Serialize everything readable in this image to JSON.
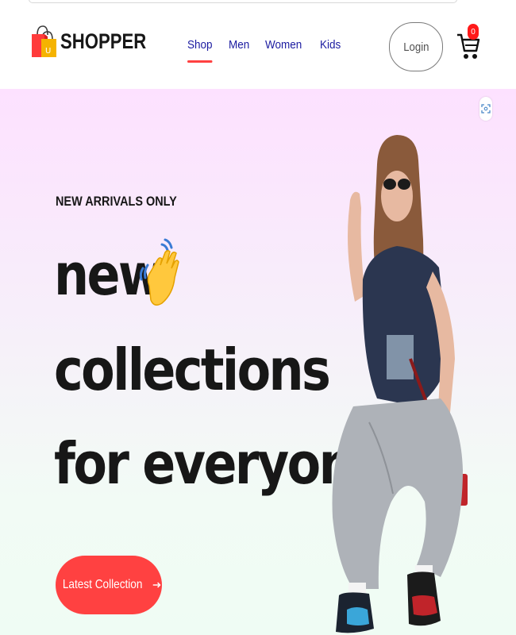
{
  "brand": {
    "name": "SHOPPER",
    "bag_letter": "U",
    "colors": {
      "bag_red": "#ff3b3b",
      "bag_yellow": "#f5b300",
      "text": "#171717"
    }
  },
  "nav": {
    "items": [
      {
        "label": "Shop",
        "active": true
      },
      {
        "label": "Men",
        "active": false
      },
      {
        "label": "Women",
        "active": false
      },
      {
        "label": "Kids",
        "active": false
      }
    ],
    "link_color": "#1a1aa0",
    "active_underline_color": "#ff4141"
  },
  "login": {
    "label": "Login"
  },
  "cart": {
    "icon": "cart-icon",
    "count": "0",
    "badge_color": "#ff1a1a"
  },
  "hero": {
    "eyebrow": "NEW ARRIVALS ONLY",
    "line1": "new",
    "line2": "collections",
    "line3": "for everyone",
    "hand_icon": "waving-hand-icon",
    "cta_label": "Latest Collection",
    "cta_icon": "arrow-right-icon",
    "cta_color": "#ff4141",
    "gradient_top": "#fde1ff",
    "gradient_bottom": "#effcf4"
  },
  "misc": {
    "scan_icon": "screenshot-scan-icon"
  }
}
